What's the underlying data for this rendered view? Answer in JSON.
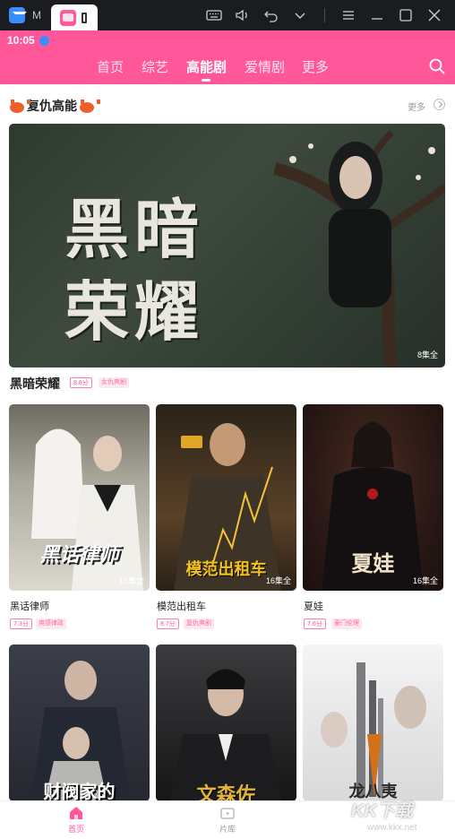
{
  "window": {
    "tab_m_label": "M",
    "active_tab_label": ""
  },
  "status": {
    "time": "10:05"
  },
  "nav": {
    "items": [
      "首页",
      "综艺",
      "高能剧",
      "爱情剧",
      "更多"
    ],
    "active_index": 2
  },
  "section": {
    "title": "复仇高能",
    "more": "更多"
  },
  "hero": {
    "poster_text_line1": "黑暗",
    "poster_text_line2": "荣耀",
    "episode_count": "8集全",
    "title": "黑暗荣耀",
    "score": "8.8分",
    "genre": "女仇爽剧"
  },
  "cards": [
    {
      "title": "黑话律师",
      "poster_text": "黑话律师",
      "episode_count": "16集全",
      "score": "7.3分",
      "genre": "爽感律政",
      "poster_color": "#8c8a7c"
    },
    {
      "title": "模范出租车",
      "poster_text": "模范出租车",
      "episode_count": "16集全",
      "score": "8.7分",
      "genre": "复仇爽剧",
      "poster_color": "#3a2f22"
    },
    {
      "title": "夏娃",
      "poster_text": "夏娃",
      "episode_count": "16集全",
      "score": "7.6分",
      "genre": "豪门伦理",
      "poster_color": "#3b1f1a"
    },
    {
      "title": "",
      "poster_text": "财阀家的",
      "episode_count": "",
      "score": "",
      "genre": "",
      "poster_color": "#2a2a2e"
    },
    {
      "title": "",
      "poster_text": "文森佐",
      "episode_count": "",
      "score": "",
      "genre": "",
      "poster_color": "#1d1d1f"
    },
    {
      "title": "",
      "poster_text": "龙八夷",
      "episode_count": "",
      "score": "",
      "genre": "",
      "poster_color": "#e9e9ea"
    }
  ],
  "tabbar": {
    "home": "首页",
    "library": "片库"
  },
  "watermark": {
    "main": "KK下载",
    "sub": "www.kkx.net"
  },
  "colors": {
    "brand": "#ff579a",
    "tag_text": "#ff4f8a"
  }
}
